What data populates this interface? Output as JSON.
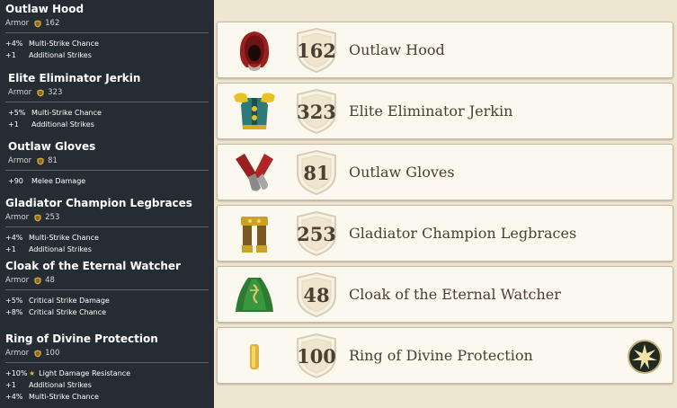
{
  "tooltips": [
    {
      "name": "Outlaw Hood",
      "armor_label": "Armor",
      "armor": "162",
      "stats": [
        {
          "value": "+4%",
          "label": "Multi-Strike Chance",
          "icon": ""
        },
        {
          "value": "+1",
          "label": "Additional Strikes",
          "icon": ""
        }
      ]
    },
    {
      "name": "Elite Eliminator Jerkin",
      "armor_label": "Armor",
      "armor": "323",
      "stats": [
        {
          "value": "+5%",
          "label": "Multi-Strike Chance",
          "icon": ""
        },
        {
          "value": "+1",
          "label": "Additional Strikes",
          "icon": ""
        }
      ]
    },
    {
      "name": "Outlaw Gloves",
      "armor_label": "Armor",
      "armor": "81",
      "stats": [
        {
          "value": "+90",
          "label": "Melee Damage",
          "icon": ""
        }
      ]
    },
    {
      "name": "Gladiator Champion Legbraces",
      "armor_label": "Armor",
      "armor": "253",
      "stats": [
        {
          "value": "+4%",
          "label": "Multi-Strike Chance",
          "icon": ""
        },
        {
          "value": "+1",
          "label": "Additional Strikes",
          "icon": ""
        }
      ]
    },
    {
      "name": "Cloak of the Eternal Watcher",
      "armor_label": "Armor",
      "armor": "48",
      "stats": [
        {
          "value": "+5%",
          "label": "Critical Strike Damage",
          "icon": ""
        },
        {
          "value": "+8%",
          "label": "Critical Strike Chance",
          "icon": ""
        }
      ]
    },
    {
      "name": "Ring of Divine Protection",
      "armor_label": "Armor",
      "armor": "100",
      "stats": [
        {
          "value": "+10%",
          "label": "Light Damage Resistance",
          "icon": "star-icon"
        },
        {
          "value": "+1",
          "label": "Additional Strikes",
          "icon": ""
        },
        {
          "value": "+4%",
          "label": "Multi-Strike Chance",
          "icon": ""
        }
      ]
    }
  ],
  "cards": [
    {
      "armor": "162",
      "name": "Outlaw Hood",
      "icon": "hood-icon"
    },
    {
      "armor": "323",
      "name": "Elite Eliminator Jerkin",
      "icon": "jerkin-icon"
    },
    {
      "armor": "81",
      "name": "Outlaw Gloves",
      "icon": "gloves-icon"
    },
    {
      "armor": "253",
      "name": "Gladiator Champion Legbraces",
      "icon": "legbraces-icon"
    },
    {
      "armor": "48",
      "name": "Cloak of the Eternal Watcher",
      "icon": "cloak-icon"
    },
    {
      "armor": "100",
      "name": "Ring of Divine Protection",
      "icon": "ring-icon",
      "enchant_icon": "sun-emblem-icon"
    }
  ],
  "colors": {
    "panel": "#262c33",
    "parchment": "#efe6d2",
    "card": "#fbf8ef",
    "text": "#4a4030",
    "gold": "#e0b43a"
  }
}
